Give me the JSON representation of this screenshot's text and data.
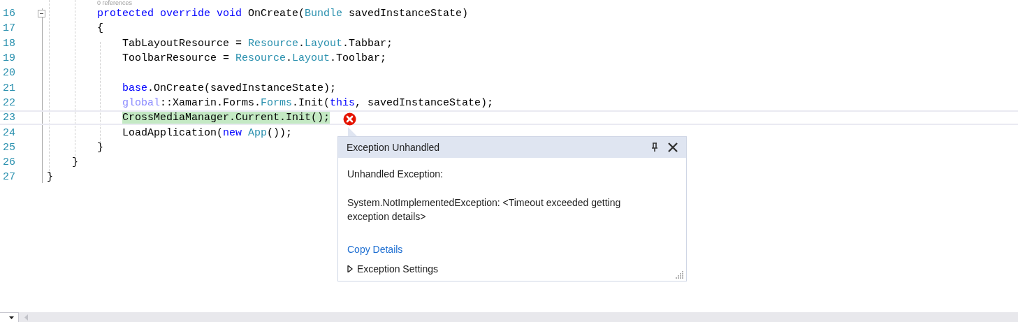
{
  "code_lens": "0 references",
  "code": [
    {
      "children": [
        {
          "children": [
            {
              "number": "16",
              "current": false,
              "tokens": [
                {
                  "text": "protected ",
                  "kind": "keyword"
                },
                {
                  "text": "override ",
                  "kind": "keyword"
                },
                {
                  "text": "void ",
                  "kind": "keyword"
                },
                {
                  "text": "OnCreate("
                },
                {
                  "text": "Bundle",
                  "kind": "type"
                },
                {
                  "text": " savedInstanceState)"
                }
              ]
            },
            {
              "number": "17",
              "current": false,
              "tokens": [
                {
                  "text": "{"
                }
              ]
            },
            {
              "children": [
                {
                  "number": "18",
                  "current": false,
                  "tokens": [
                    {
                      "text": "TabLayoutResource = "
                    },
                    {
                      "text": "Resource",
                      "kind": "type"
                    },
                    {
                      "text": "."
                    },
                    {
                      "text": "Layout",
                      "kind": "type"
                    },
                    {
                      "text": ".Tabbar;"
                    }
                  ]
                },
                {
                  "number": "19",
                  "current": false,
                  "tokens": [
                    {
                      "text": "ToolbarResource = "
                    },
                    {
                      "text": "Resource",
                      "kind": "type"
                    },
                    {
                      "text": "."
                    },
                    {
                      "text": "Layout",
                      "kind": "type"
                    },
                    {
                      "text": ".Toolbar;"
                    }
                  ]
                },
                {
                  "number": "20",
                  "current": false
                },
                {
                  "number": "21",
                  "current": false,
                  "tokens": [
                    {
                      "text": "base",
                      "kind": "keyword"
                    },
                    {
                      "text": ".OnCreate(savedInstanceState);"
                    }
                  ]
                },
                {
                  "number": "22",
                  "current": false,
                  "tokens": [
                    {
                      "text": "global",
                      "kind": "alias"
                    },
                    {
                      "text": "::Xamarin.Forms."
                    },
                    {
                      "text": "Forms",
                      "kind": "type"
                    },
                    {
                      "text": ".Init("
                    },
                    {
                      "text": "this",
                      "kind": "keyword"
                    },
                    {
                      "text": ", savedInstanceState);"
                    }
                  ]
                },
                {
                  "number": "23",
                  "current": true,
                  "tokens": [
                    {
                      "text": "CrossMediaManager.Current.Init();",
                      "highlighted": true
                    }
                  ]
                },
                {
                  "number": "24",
                  "current": false,
                  "tokens": [
                    {
                      "text": "LoadApplication("
                    },
                    {
                      "text": "new ",
                      "kind": "keyword"
                    },
                    {
                      "text": "App",
                      "kind": "type"
                    },
                    {
                      "text": "());"
                    }
                  ]
                }
              ]
            },
            {
              "number": "25",
              "current": false,
              "tokens": [
                {
                  "text": "}"
                }
              ]
            }
          ]
        },
        {
          "number": "26",
          "current": false,
          "tokens": [
            {
              "text": "}"
            }
          ]
        }
      ]
    },
    {
      "number": "27",
      "current": false,
      "tokens": [
        {
          "text": "}"
        }
      ]
    }
  ],
  "popup": {
    "title": "Exception Unhandled",
    "heading": "Unhandled Exception:",
    "message": "System.NotImplementedException: <Timeout exceeded getting exception details>",
    "link": "Copy Details",
    "settings": {
      "label": "Exception Settings",
      "expanded": false
    }
  }
}
